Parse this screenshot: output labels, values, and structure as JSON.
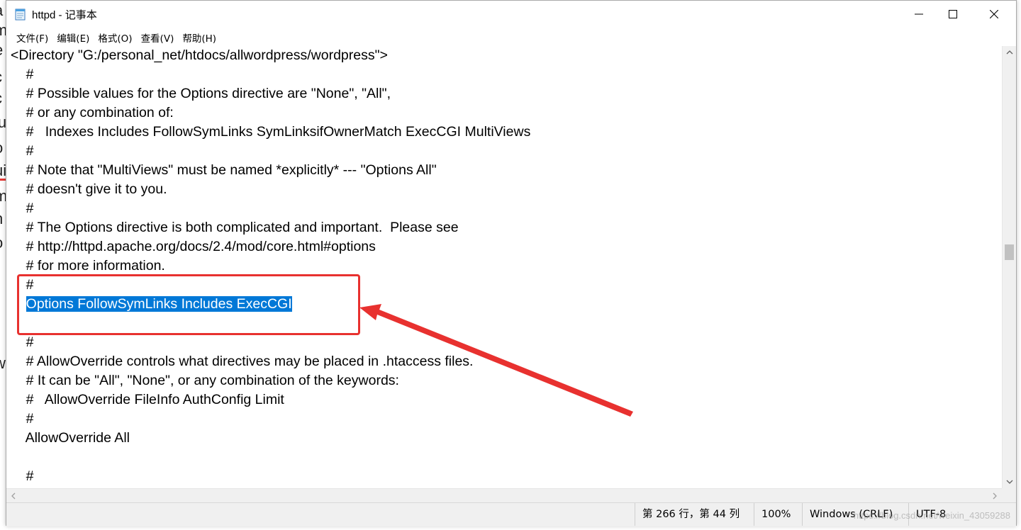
{
  "window": {
    "title": "httpd - 记事本",
    "controls": {
      "minimize": "minimize",
      "maximize": "maximize",
      "close": "close"
    }
  },
  "menu": [
    "文件(F)",
    "编辑(E)",
    "格式(O)",
    "查看(V)",
    "帮助(H)"
  ],
  "editor": {
    "lines": [
      "<Directory \"G:/personal_net/htdocs/allwordpress/wordpress\">",
      "    #",
      "    # Possible values for the Options directive are \"None\", \"All\",",
      "    # or any combination of:",
      "    #   Indexes Includes FollowSymLinks SymLinksifOwnerMatch ExecCGI MultiViews",
      "    #",
      "    # Note that \"MultiViews\" must be named *explicitly* --- \"Options All\"",
      "    # doesn't give it to you.",
      "    #",
      "    # The Options directive is both complicated and important.  Please see",
      "    # http://httpd.apache.org/docs/2.4/mod/core.html#options",
      "    # for more information.",
      "    #",
      "    Options FollowSymLinks Includes ExecCGI",
      "",
      "    #",
      "    # AllowOverride controls what directives may be placed in .htaccess files.",
      "    # It can be \"All\", \"None\", or any combination of the keywords:",
      "    #   AllowOverride FileInfo AuthConfig Limit",
      "    #",
      "    AllowOverride All",
      "",
      "    #"
    ],
    "selected_line_index": 13
  },
  "status": {
    "position": "第 266 行，第 44 列",
    "zoom": "100%",
    "line_ending": "Windows (CRLF)",
    "encoding": "UTF-8",
    "watermark": "https://blog.csdn.net/weixin_43059288"
  },
  "background_page": {
    "letters": [
      "a",
      "m",
      "e",
      "c",
      "c",
      "lu",
      "o",
      "ui",
      "m",
      "h",
      "o",
      "r",
      "w",
      "s"
    ]
  },
  "colors": {
    "selection": "#0078d7",
    "annotation": "#e8312f",
    "statusbar": "#f0f0f0"
  }
}
